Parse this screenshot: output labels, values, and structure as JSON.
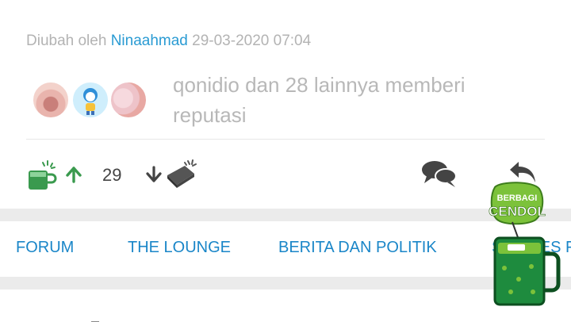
{
  "edit_info": {
    "prefix": "Diubah oleh",
    "author": "Ninaahmad",
    "timestamp": "29-03-2020 07:04"
  },
  "reputation": {
    "text": "qonidio dan 28 lainnya memberi reputasi",
    "avatars": [
      "avatar-lips",
      "avatar-doraemon-nobita",
      "avatar-pink"
    ]
  },
  "actions": {
    "cendol_icon": "green-cup-icon",
    "upvote_icon": "arrow-up-icon",
    "vote_count": "29",
    "downvote_icon": "arrow-down-icon",
    "bata_icon": "brick-icon",
    "comment_icon": "comments-icon",
    "reply_icon": "reply-icon"
  },
  "nav": {
    "items": [
      "FORUM",
      "THE LOUNGE",
      "BERITA DAN POLITIK",
      "STORIES F"
    ]
  },
  "floating_badge": {
    "line1": "BERBAGI",
    "line2": "CENDOL"
  },
  "colors": {
    "author_link": "#2a9bd3",
    "nav_link": "#1a86c8",
    "upvote_green": "#3a9a4e",
    "badge_green": "#7cc23a"
  }
}
